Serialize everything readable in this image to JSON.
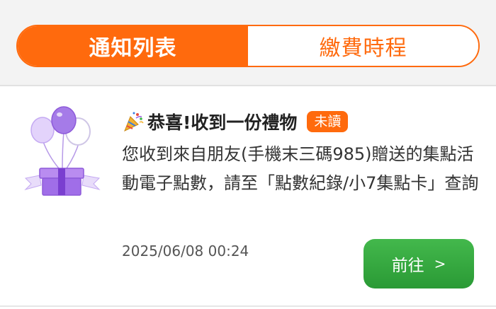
{
  "tabs": [
    {
      "label": "通知列表",
      "active": true
    },
    {
      "label": "繳費時程",
      "active": false
    }
  ],
  "notification": {
    "icon": "party-popper-icon",
    "title": "恭喜!收到一份禮物",
    "badge": "未讀",
    "body": "您收到來自朋友(手機末三碼985)贈送的集點活動電子點數，請至「點數紀錄/小7集點卡」查詢",
    "timestamp": "2025/06/08 00:24",
    "action_label": "前往",
    "action_chevron": ">"
  },
  "colors": {
    "accent": "#ff6a0d",
    "button_green": "#2fa63a",
    "gift_purple": "#9b5fe0"
  }
}
